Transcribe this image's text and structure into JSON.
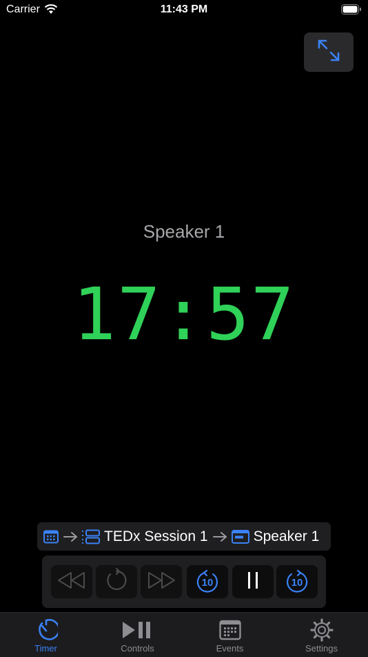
{
  "status_bar": {
    "carrier": "Carrier",
    "time": "11:43 PM"
  },
  "timer": {
    "speaker_name": "Speaker 1",
    "time": "17:57"
  },
  "breadcrumb": {
    "session": "TEDx Session 1",
    "speaker": "Speaker 1"
  },
  "controls": {
    "skip_back_label": "10",
    "skip_forward_label": "10"
  },
  "tabs": [
    {
      "label": "Timer",
      "icon": "timer-icon",
      "selected": true
    },
    {
      "label": "Controls",
      "icon": "play-pause-icon",
      "selected": false
    },
    {
      "label": "Events",
      "icon": "calendar-icon",
      "selected": false
    },
    {
      "label": "Settings",
      "icon": "gear-icon",
      "selected": false
    }
  ],
  "colors": {
    "accent": "#3a82f6",
    "timer": "#2fd158",
    "background": "#000000"
  }
}
